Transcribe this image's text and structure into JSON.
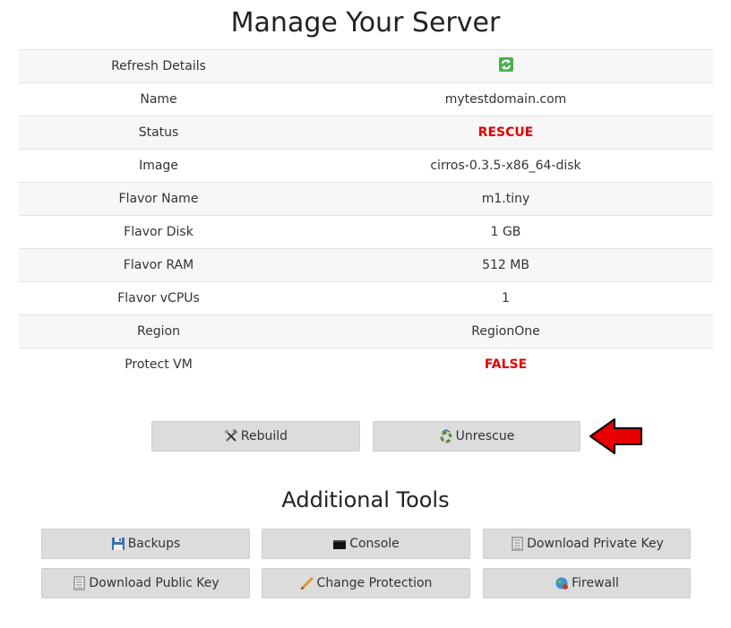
{
  "page": {
    "title": "Manage Your Server",
    "additional_title": "Additional Tools"
  },
  "details": [
    {
      "label": "Refresh Details",
      "value": "",
      "icon": "refresh-icon"
    },
    {
      "label": "Name",
      "value": "mytestdomain.com"
    },
    {
      "label": "Status",
      "value": "RESCUE",
      "color": "#e00000"
    },
    {
      "label": "Image",
      "value": "cirros-0.3.5-x86_64-disk"
    },
    {
      "label": "Flavor Name",
      "value": "m1.tiny"
    },
    {
      "label": "Flavor Disk",
      "value": "1 GB"
    },
    {
      "label": "Flavor RAM",
      "value": "512 MB"
    },
    {
      "label": "Flavor vCPUs",
      "value": "1"
    },
    {
      "label": "Region",
      "value": "RegionOne"
    },
    {
      "label": "Protect VM",
      "value": "FALSE",
      "color": "#e00000"
    }
  ],
  "actions": {
    "rebuild": "Rebuild",
    "unrescue": "Unrescue"
  },
  "tools": {
    "backups": "Backups",
    "console": "Console",
    "download_private_key": "Download Private Key",
    "download_public_key": "Download Public Key",
    "change_protection": "Change Protection",
    "firewall": "Firewall"
  },
  "colors": {
    "accent_red": "#e00000",
    "button_bg": "#dcdcdc"
  }
}
